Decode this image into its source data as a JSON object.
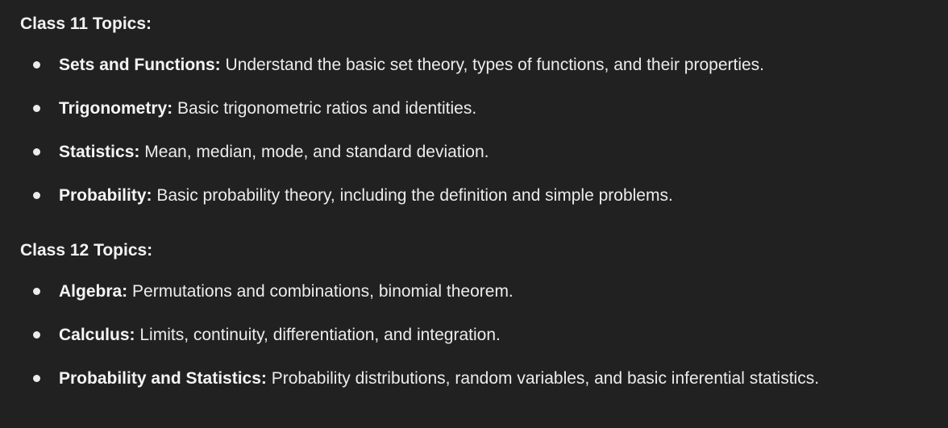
{
  "sections": [
    {
      "heading": "Class 11 Topics:",
      "items": [
        {
          "term": "Sets and Functions:",
          "desc": " Understand the basic set theory, types of functions, and their properties."
        },
        {
          "term": "Trigonometry:",
          "desc": " Basic trigonometric ratios and identities."
        },
        {
          "term": "Statistics:",
          "desc": " Mean, median, mode, and standard deviation."
        },
        {
          "term": "Probability:",
          "desc": " Basic probability theory, including the definition and simple problems."
        }
      ]
    },
    {
      "heading": "Class 12 Topics:",
      "items": [
        {
          "term": "Algebra:",
          "desc": " Permutations and combinations, binomial theorem."
        },
        {
          "term": "Calculus:",
          "desc": " Limits, continuity, differentiation, and integration."
        },
        {
          "term": "Probability and Statistics:",
          "desc": " Probability distributions, random variables, and basic inferential statistics."
        }
      ]
    }
  ]
}
